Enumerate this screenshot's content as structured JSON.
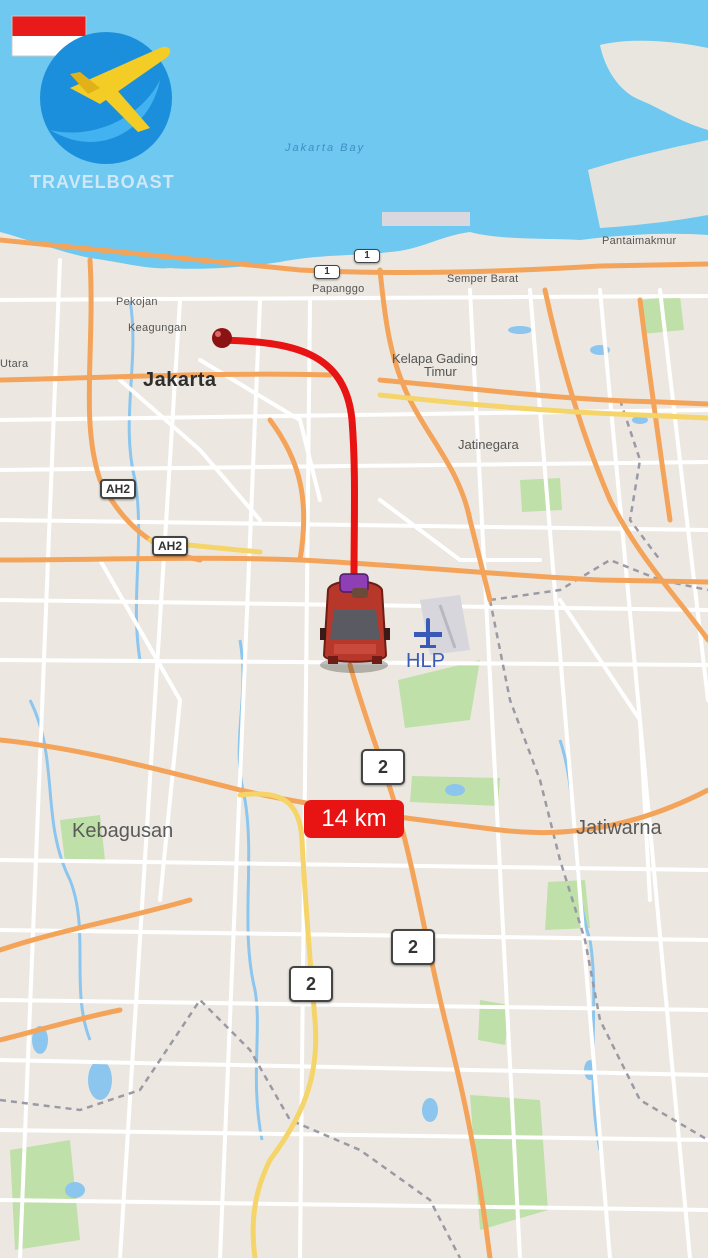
{
  "brand": {
    "name": "TRAVELBOAST",
    "flag": "indonesia-flag",
    "logo_icon": "airplane-globe-icon"
  },
  "colors": {
    "sea": "#6ec8ef",
    "land": "#ece8e1",
    "route": "#e81414",
    "major_road": "#f4a45a",
    "highway": "#f5d46a",
    "park": "#bfe0a8",
    "water": "#8cc6ee"
  },
  "water_label": "Jakarta Bay",
  "labels": {
    "jakarta": "Jakarta",
    "pekojan": "Pekojan",
    "keagungan": "Keagungan",
    "utara": "Utara",
    "papanggo": "Papanggo",
    "semper_barat": "Semper Barat",
    "pantaimakmur": "Pantaimakmur",
    "kelapa_gading": "Kelapa Gading",
    "timur": "Timur",
    "jatinegara": "Jatinegara",
    "kebagusan": "Kebagusan",
    "jatiwarna": "Jatiwarna"
  },
  "route_shields": {
    "ah2_a": "AH2",
    "ah2_b": "AH2",
    "r1_a": "1",
    "r1_b": "1",
    "r2_a": "2",
    "r2_b": "2",
    "r2_c": "2"
  },
  "airport": {
    "code": "HLP",
    "icon": "airplane-icon"
  },
  "route": {
    "distance": "14 km",
    "vehicle_icon": "car-icon",
    "origin_icon": "origin-pin-icon"
  }
}
